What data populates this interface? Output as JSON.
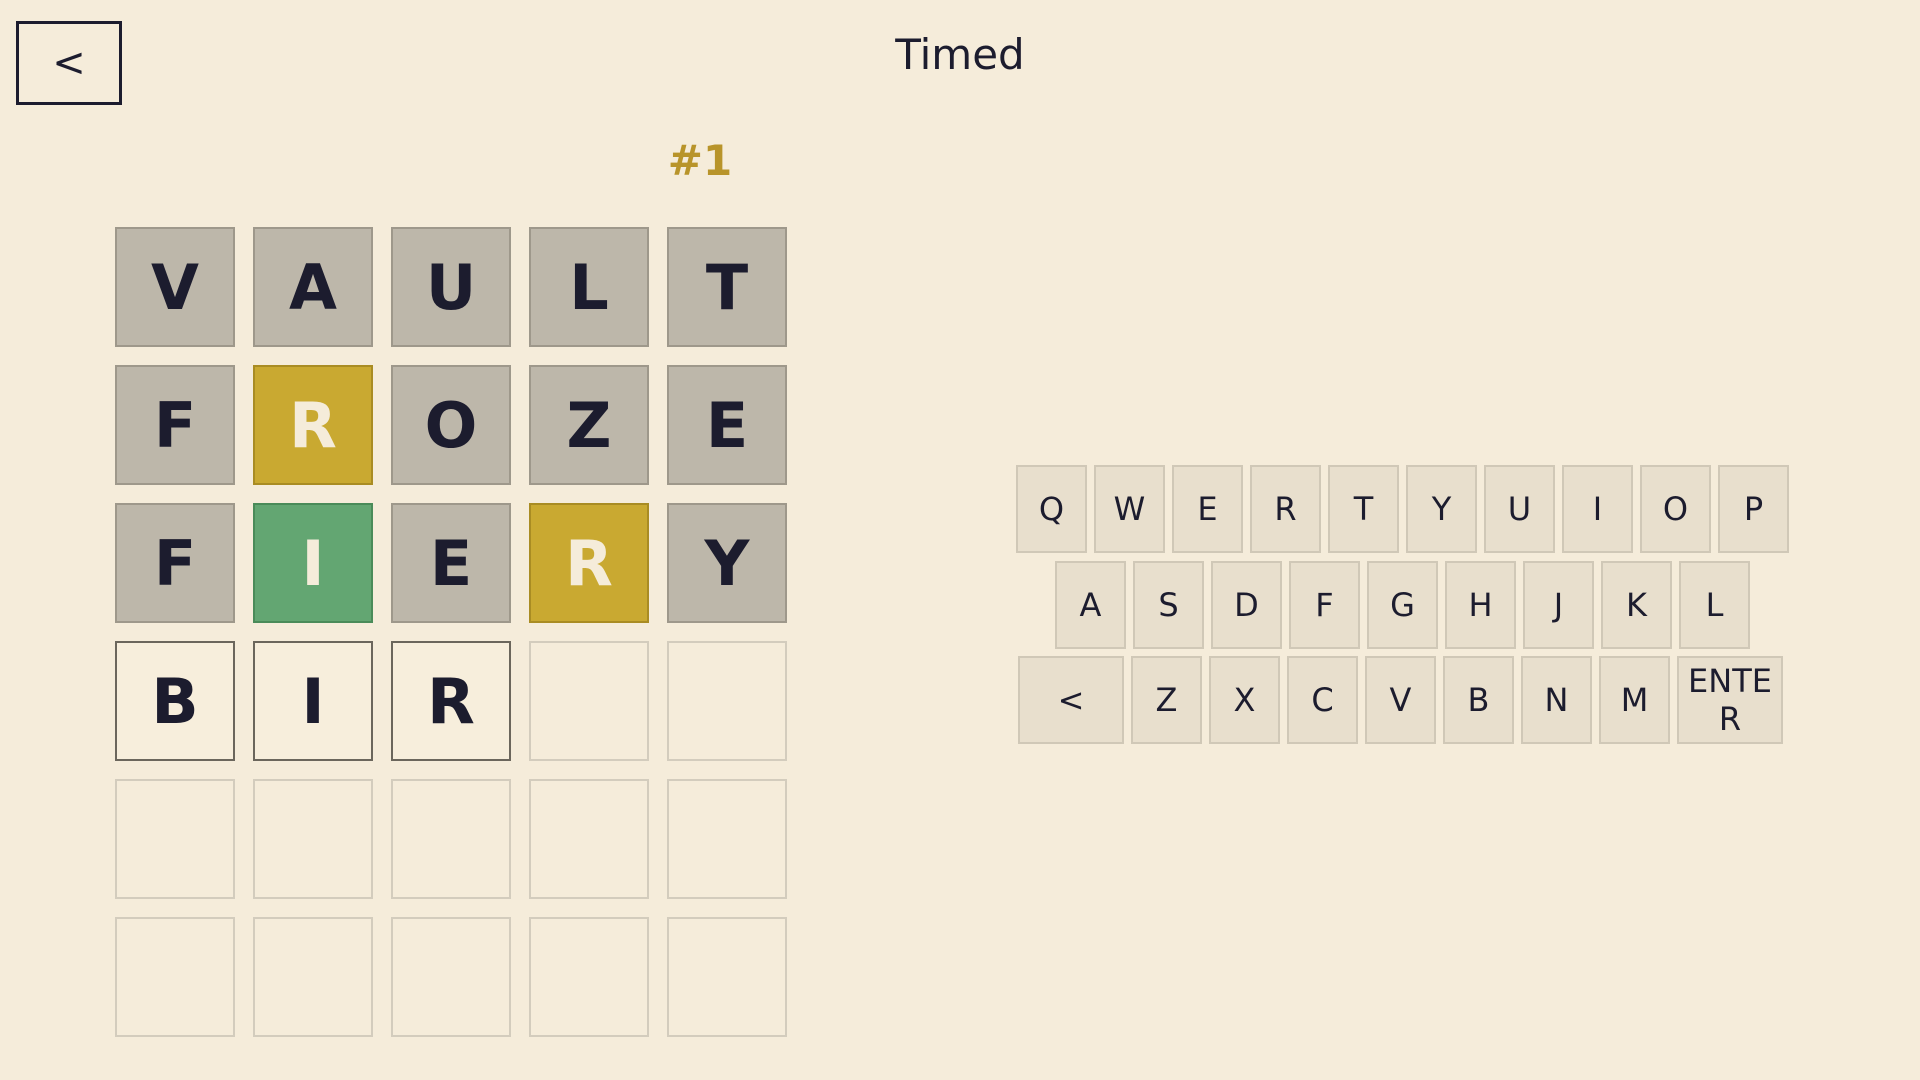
{
  "header": {
    "back_label": "<",
    "title": "Timed"
  },
  "game_number": "#1",
  "board": {
    "rows": [
      [
        {
          "letter": "V",
          "state": "absent"
        },
        {
          "letter": "A",
          "state": "absent"
        },
        {
          "letter": "U",
          "state": "absent"
        },
        {
          "letter": "L",
          "state": "absent"
        },
        {
          "letter": "T",
          "state": "absent"
        }
      ],
      [
        {
          "letter": "F",
          "state": "absent"
        },
        {
          "letter": "R",
          "state": "present"
        },
        {
          "letter": "O",
          "state": "absent"
        },
        {
          "letter": "Z",
          "state": "absent"
        },
        {
          "letter": "E",
          "state": "absent"
        }
      ],
      [
        {
          "letter": "F",
          "state": "absent"
        },
        {
          "letter": "I",
          "state": "correct"
        },
        {
          "letter": "E",
          "state": "absent"
        },
        {
          "letter": "R",
          "state": "present"
        },
        {
          "letter": "Y",
          "state": "absent"
        }
      ],
      [
        {
          "letter": "B",
          "state": "filled"
        },
        {
          "letter": "I",
          "state": "filled"
        },
        {
          "letter": "R",
          "state": "filled"
        },
        {
          "letter": "",
          "state": "empty"
        },
        {
          "letter": "",
          "state": "empty"
        }
      ],
      [
        {
          "letter": "",
          "state": "empty"
        },
        {
          "letter": "",
          "state": "empty"
        },
        {
          "letter": "",
          "state": "empty"
        },
        {
          "letter": "",
          "state": "empty"
        },
        {
          "letter": "",
          "state": "empty"
        }
      ],
      [
        {
          "letter": "",
          "state": "empty"
        },
        {
          "letter": "",
          "state": "empty"
        },
        {
          "letter": "",
          "state": "empty"
        },
        {
          "letter": "",
          "state": "empty"
        },
        {
          "letter": "",
          "state": "empty"
        }
      ]
    ]
  },
  "keyboard": {
    "row1": [
      "Q",
      "W",
      "E",
      "R",
      "T",
      "Y",
      "U",
      "I",
      "O",
      "P"
    ],
    "row2": [
      "A",
      "S",
      "D",
      "F",
      "G",
      "H",
      "J",
      "K",
      "L"
    ],
    "row3": [
      "<",
      "Z",
      "X",
      "C",
      "V",
      "B",
      "N",
      "M",
      "ENTER"
    ]
  },
  "colors": {
    "background": "#f5ecda",
    "absent": "#bdb7aa",
    "present": "#c9a931",
    "correct": "#63a672",
    "accent": "#b8942a"
  }
}
